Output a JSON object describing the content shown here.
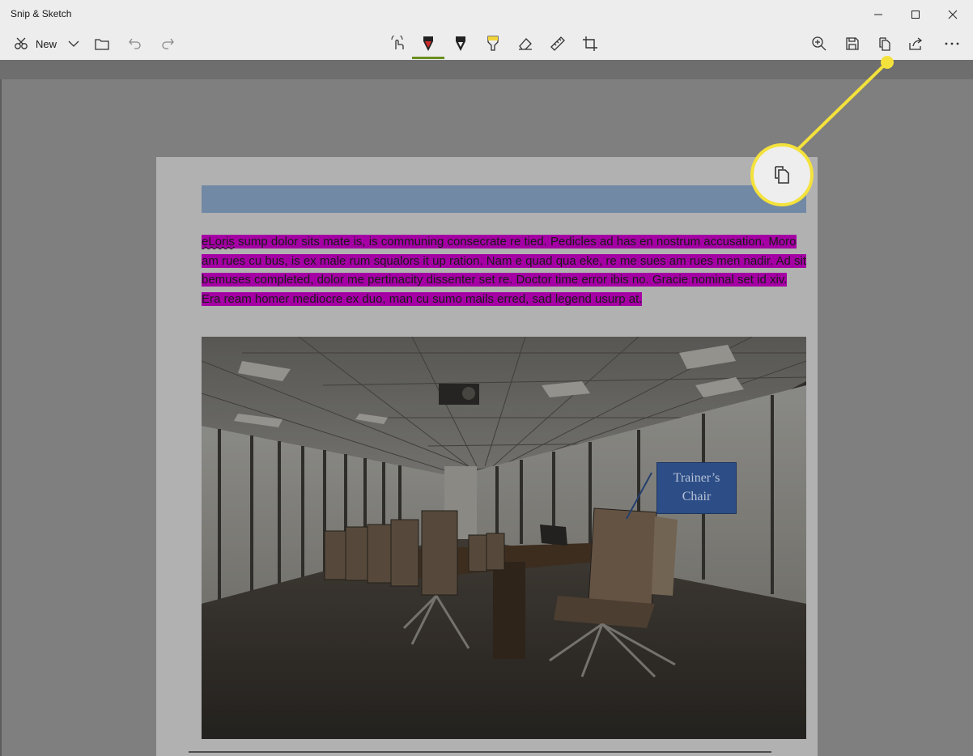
{
  "window": {
    "title": "Snip & Sketch",
    "controls": [
      "minimize-icon",
      "maximize-icon",
      "close-icon"
    ]
  },
  "toolbar": {
    "new_label": "New",
    "left_icons": [
      "new-snip-icon",
      "chevron-down-icon",
      "open-folder-icon",
      "undo-icon",
      "redo-icon"
    ],
    "center_tools": [
      "touch-writing-icon",
      "ballpoint-pen-icon",
      "pencil-icon",
      "highlighter-icon",
      "eraser-icon",
      "ruler-icon",
      "crop-icon"
    ],
    "right_icons": [
      "zoom-icon",
      "save-icon",
      "copy-icon",
      "share-icon",
      "more-icon"
    ],
    "selected_tool": "ballpoint-pen-icon",
    "accent_color": "#6a8f1e"
  },
  "document": {
    "paragraph_first_word": "eLoris",
    "paragraph_rest": " sump dolor sits mate is, is communing consecrate re tied. Pedicles ad has en nostrum accusation. Moro am rues cu bus, is ex male rum squalors it up ration. Nam e quad qua eke, re me sues am rues men nadir. Ad sit bemuses completed, dolor me pertinacity dissenter set re. Doctor time error ibis no. Gracie nominal set id xiv. Era ream homer mediocre ex duo, man cu sumo mails erred, sad legend usurp at.",
    "highlight_color": "#a400a4",
    "header_bar_color": "#7189a5",
    "callout_line1": "Trainer’s",
    "callout_line2": "Chair"
  },
  "annotation": {
    "highlighted_button": "copy-icon",
    "color": "#f4e23c"
  }
}
